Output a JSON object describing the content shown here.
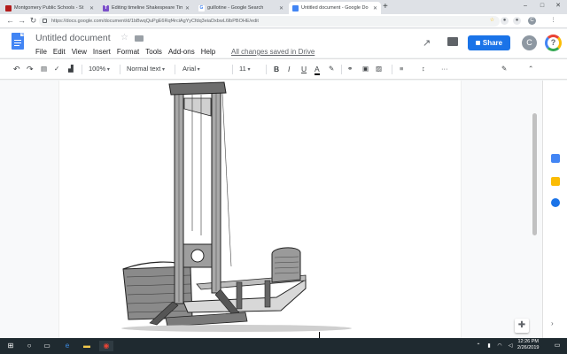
{
  "browser": {
    "tabs": [
      {
        "label": "Montgomery Public Schools - St",
        "favicon_color": "#b31b1b",
        "favicon_glyph": ""
      },
      {
        "label": "Editing timeline Shakespeare Tim",
        "favicon_color": "#7b4fc9",
        "favicon_glyph": "T"
      },
      {
        "label": "guillotine - Google Search",
        "favicon_color": "#ffffff",
        "favicon_glyph": "G"
      },
      {
        "label": "Untitled document - Google Do",
        "favicon_color": "#4285f4",
        "favicon_glyph": ""
      }
    ],
    "new_tab_label": "+",
    "url": "https://docs.google.com/document/d/1bBwqQuPgE6Rqf4rciAgYyCfdq3eiaDxbwL6lbPBOHE/edit",
    "window_controls": [
      "–",
      "□",
      "✕"
    ]
  },
  "docs": {
    "title": "Untitled document",
    "menu": [
      "File",
      "Edit",
      "View",
      "Insert",
      "Format",
      "Tools",
      "Add-ons",
      "Help"
    ],
    "saved_status": "All changes saved in Drive",
    "share_label": "Share",
    "avatar_letter": "C",
    "help_glyph": "?"
  },
  "toolbar": {
    "zoom": "100%",
    "style": "Normal text",
    "font": "Arial",
    "size": "11",
    "bold": "B",
    "italic": "I",
    "underline": "U",
    "text_color": "A",
    "more": "···"
  },
  "taskbar": {
    "time": "12:26 PM",
    "date": "2/26/2019"
  },
  "icons": {
    "accent": "#1a73e8",
    "keep_color": "#fbbc04",
    "tasks_color": "#1a73e8",
    "calendar_color": "#4285f4"
  }
}
